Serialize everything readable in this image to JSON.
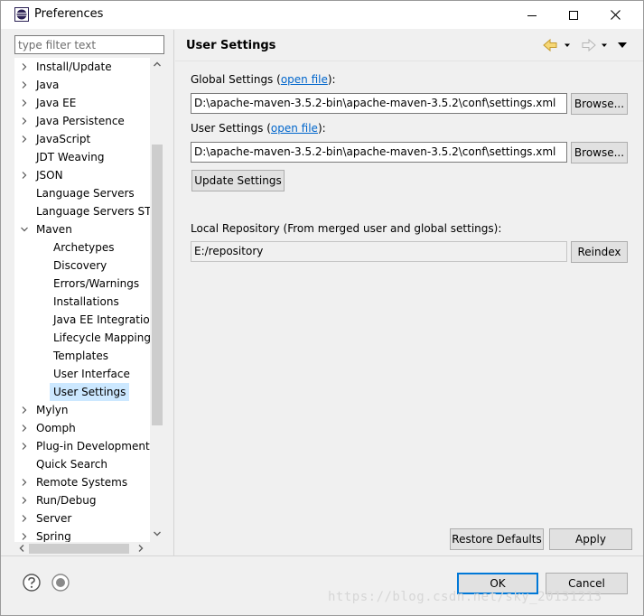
{
  "window": {
    "title": "Preferences"
  },
  "left": {
    "filter_placeholder": "type filter text",
    "tree": [
      {
        "label": "Install/Update",
        "level": 0,
        "expander": "collapsed"
      },
      {
        "label": "Java",
        "level": 0,
        "expander": "collapsed"
      },
      {
        "label": "Java EE",
        "level": 0,
        "expander": "collapsed"
      },
      {
        "label": "Java Persistence",
        "level": 0,
        "expander": "collapsed"
      },
      {
        "label": "JavaScript",
        "level": 0,
        "expander": "collapsed"
      },
      {
        "label": "JDT Weaving",
        "level": 0,
        "expander": "none"
      },
      {
        "label": "JSON",
        "level": 0,
        "expander": "collapsed"
      },
      {
        "label": "Language Servers",
        "level": 0,
        "expander": "none"
      },
      {
        "label": "Language Servers STS",
        "level": 0,
        "expander": "none"
      },
      {
        "label": "Maven",
        "level": 0,
        "expander": "expanded"
      },
      {
        "label": "Archetypes",
        "level": 1,
        "expander": "none"
      },
      {
        "label": "Discovery",
        "level": 1,
        "expander": "none"
      },
      {
        "label": "Errors/Warnings",
        "level": 1,
        "expander": "none"
      },
      {
        "label": "Installations",
        "level": 1,
        "expander": "none"
      },
      {
        "label": "Java EE Integration",
        "level": 1,
        "expander": "none"
      },
      {
        "label": "Lifecycle Mapping",
        "level": 1,
        "expander": "none"
      },
      {
        "label": "Templates",
        "level": 1,
        "expander": "none"
      },
      {
        "label": "User Interface",
        "level": 1,
        "expander": "none"
      },
      {
        "label": "User Settings",
        "level": 1,
        "expander": "none",
        "selected": true
      },
      {
        "label": "Mylyn",
        "level": 0,
        "expander": "collapsed"
      },
      {
        "label": "Oomph",
        "level": 0,
        "expander": "collapsed"
      },
      {
        "label": "Plug-in Development",
        "level": 0,
        "expander": "collapsed"
      },
      {
        "label": "Quick Search",
        "level": 0,
        "expander": "none"
      },
      {
        "label": "Remote Systems",
        "level": 0,
        "expander": "collapsed"
      },
      {
        "label": "Run/Debug",
        "level": 0,
        "expander": "collapsed"
      },
      {
        "label": "Server",
        "level": 0,
        "expander": "collapsed"
      },
      {
        "label": "Spring",
        "level": 0,
        "expander": "collapsed"
      }
    ]
  },
  "page": {
    "title": "User Settings",
    "global_label": "Global Settings (",
    "global_link": "open file",
    "global_label_end": "):",
    "global_path": "D:\\apache-maven-3.5.2-bin\\apache-maven-3.5.2\\conf\\settings.xml",
    "user_label": "User Settings (",
    "user_link": "open file",
    "user_label_end": "):",
    "user_path": "D:\\apache-maven-3.5.2-bin\\apache-maven-3.5.2\\conf\\settings.xml",
    "browse_label": "Browse...",
    "update_label": "Update Settings",
    "local_repo_label": "Local Repository (From merged user and global settings):",
    "local_repo_path": "E:/repository",
    "reindex_label": "Reindex",
    "restore_label": "Restore Defaults",
    "apply_label": "Apply"
  },
  "footer": {
    "ok_label": "OK",
    "cancel_label": "Cancel",
    "watermark": "https://blog.csdn.net/sky_20131213"
  },
  "colors": {
    "selection": "#cce8ff",
    "link": "#0066cc",
    "default_button_border": "#0078d7",
    "nav_arrow": "#f0c050"
  }
}
